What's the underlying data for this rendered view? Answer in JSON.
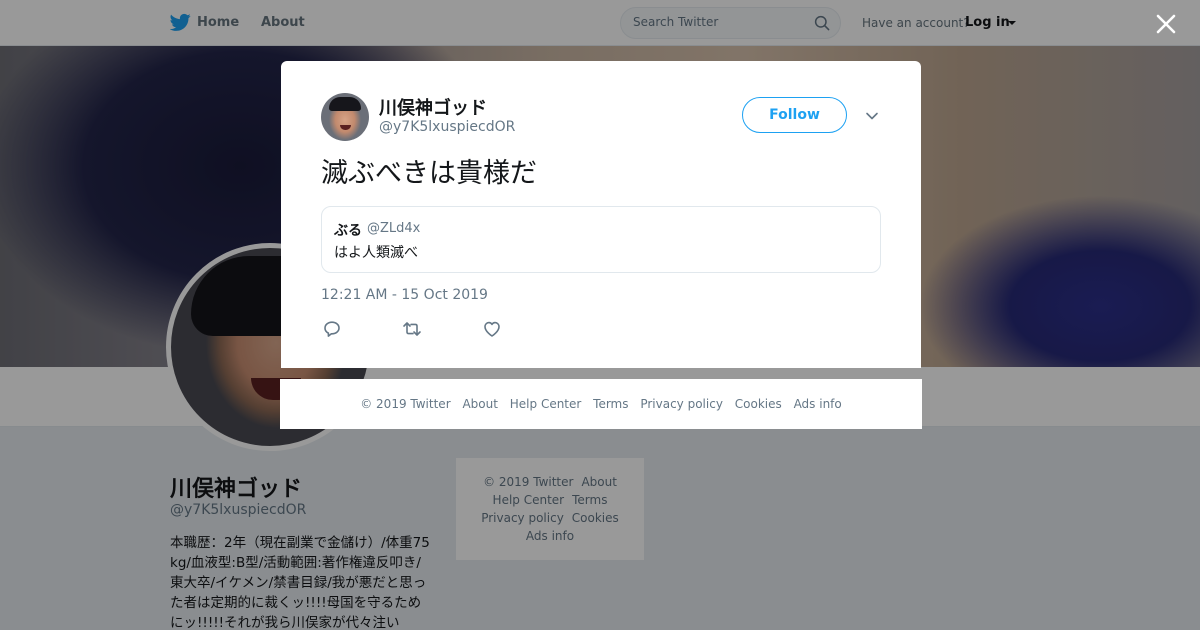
{
  "topbar": {
    "home_label": "Home",
    "about_label": "About",
    "search_placeholder": "Search Twitter",
    "have_account": "Have an account?",
    "login_label": "Log in"
  },
  "profile": {
    "name": "川俣神ゴッド",
    "handle": "@y7K5lxuspiecdOR",
    "bio": "本職歴：2年（現在副業で金儲け）/体重75kg/血液型:B型/活動範囲:著作権違反叩き/東大卒/イケメン/禁書目録/我が悪だと思った者は定期的に裁くッ!!!!母国を守るためにッ!!!!!それが我ら川俣家が代々注い"
  },
  "side_footer": {
    "copyright": "© 2019 Twitter",
    "about": "About",
    "help": "Help Center",
    "terms": "Terms",
    "privacy": "Privacy policy",
    "cookies": "Cookies",
    "ads": "Ads info"
  },
  "tweet": {
    "author_name": "川俣神ゴッド",
    "author_handle": "@y7K5lxuspiecdOR",
    "follow_label": "Follow",
    "text": "滅ぶべきは貴様だ",
    "quote": {
      "name": "ぶる",
      "handle": "@ZLd4x",
      "text": "はよ人類滅べ"
    },
    "timestamp": "12:21 AM - 15 Oct 2019"
  },
  "modal_footer": {
    "copyright": "© 2019 Twitter",
    "about": "About",
    "help": "Help Center",
    "terms": "Terms",
    "privacy": "Privacy policy",
    "cookies": "Cookies",
    "ads": "Ads info"
  },
  "icons": {
    "brand": "twitter-bird-icon",
    "search": "search-icon",
    "close": "close-icon",
    "menu": "chevron-down-icon",
    "reply": "reply-icon",
    "retweet": "retweet-icon",
    "like": "heart-icon"
  },
  "colors": {
    "brand_blue": "#1da1f2",
    "secondary_text": "#657786",
    "overlay": "rgba(0,0,0,0.40)"
  }
}
